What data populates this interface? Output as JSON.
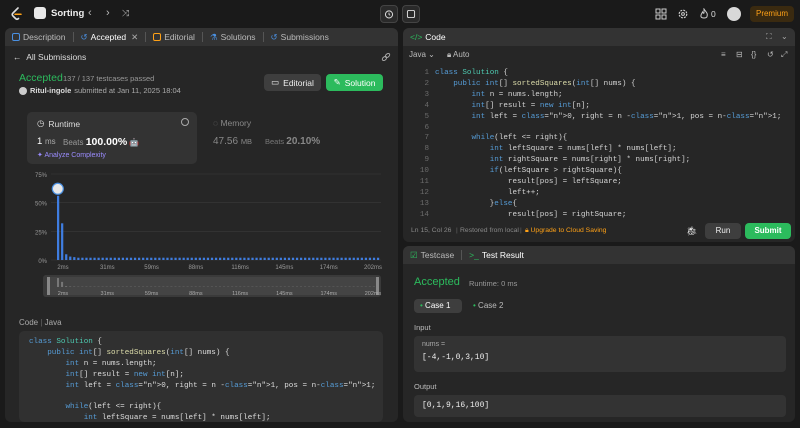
{
  "topnav": {
    "problem_list_label": "Sorting",
    "coins": "0",
    "premium_label": "Premium",
    "colors": {
      "premium_text": "#ffa116",
      "accent_green": "#2cbb5d"
    }
  },
  "left": {
    "tabs": [
      {
        "label": "Description"
      },
      {
        "label": "Accepted"
      },
      {
        "label": "Editorial"
      },
      {
        "label": "Solutions"
      },
      {
        "label": "Submissions"
      }
    ],
    "all_submissions": "All Submissions",
    "status": "Accepted",
    "testcases": "137 / 137 testcases passed",
    "user": "Ritul-ingole",
    "submitted_text": "submitted at Jan 11, 2025 18:04",
    "editorial_button": "Editorial",
    "solution_button": "Solution",
    "runtime": {
      "title": "Runtime",
      "value": "1",
      "unit": "ms",
      "beats_label": "Beats",
      "beats_value": "100.00%",
      "analyze": "Analyze Complexity"
    },
    "memory": {
      "title": "Memory",
      "value": "47.56",
      "unit": "MB",
      "beats_label": "Beats",
      "beats_value": "20.10%"
    },
    "code_label": "Code",
    "code_lang": "Java",
    "code_lines": [
      "class Solution {",
      "    public int[] sortedSquares(int[] nums) {",
      "        int n = nums.length;",
      "        int[] result = new int[n];",
      "        int left = 0, right = n -1, pos = n-1;",
      "",
      "        while(left <= right){",
      "            int leftSquare = nums[left] * nums[left];"
    ]
  },
  "chart_data": {
    "type": "bar",
    "ylabel_ticks": [
      "75%",
      "50%",
      "25%",
      "0%"
    ],
    "ylim": [
      0,
      75
    ],
    "x_tick_labels": [
      "2ms",
      "31ms",
      "59ms",
      "88ms",
      "116ms",
      "145ms",
      "174ms",
      "202ms"
    ],
    "series": [
      {
        "values": [
          56,
          32,
          5,
          3,
          2.5,
          2,
          2,
          2,
          2,
          2,
          2,
          2,
          2,
          2,
          2,
          2,
          2,
          2,
          2,
          2,
          2,
          2,
          2,
          2,
          2,
          2,
          2,
          2,
          2,
          2,
          2,
          2,
          2,
          2,
          2,
          2,
          2,
          2,
          2,
          2,
          2,
          2,
          2,
          2,
          2,
          2,
          2,
          2,
          2,
          2,
          2,
          2,
          2,
          2,
          2,
          2,
          2,
          2,
          2,
          2,
          2,
          2,
          2,
          2,
          2,
          2,
          2,
          2,
          2,
          2,
          2,
          2,
          2,
          2,
          2,
          2,
          2,
          2,
          2,
          2
        ]
      }
    ],
    "highlighted_index": 0,
    "minimap_tick_labels": [
      "2ms",
      "31ms",
      "59ms",
      "88ms",
      "116ms",
      "145ms",
      "174ms",
      "202ms"
    ],
    "colors": {
      "bar": "#3f7de0",
      "grid": "#3a3a3a"
    }
  },
  "code": {
    "tab_label": "Code",
    "language": "Java",
    "auto_label": "Auto",
    "line_numbers": [
      "1",
      "2",
      "3",
      "4",
      "5",
      "6",
      "7",
      "8",
      "9",
      "10",
      "11",
      "12",
      "13",
      "14"
    ],
    "lines": [
      "class Solution {",
      "    public int[] sortedSquares(int[] nums) {",
      "        int n = nums.length;",
      "        int[] result = new int[n];",
      "        int left = 0, right = n -1, pos = n-1;",
      "",
      "        while(left <= right){",
      "            int leftSquare = nums[left] * nums[left];",
      "            int rightSquare = nums[right] * nums[right];",
      "            if(leftSquare > rightSquare){",
      "                result[pos] = leftSquare;",
      "                left++;",
      "            }else{",
      "                result[pos] = rightSquare;"
    ],
    "status_position": "Ln 15, Col 26",
    "status_restored": "Restored from local",
    "upgrade": "Upgrade to Cloud Saving",
    "run_button": "Run",
    "submit_button": "Submit"
  },
  "test": {
    "tabs": [
      {
        "label": "Testcase"
      },
      {
        "label": "Test Result"
      }
    ],
    "status": "Accepted",
    "runtime": "Runtime: 0 ms",
    "cases": [
      {
        "label": "Case 1"
      },
      {
        "label": "Case 2"
      }
    ],
    "input_label": "Input",
    "input_var": "nums =",
    "input_value": "[-4,-1,0,3,10]",
    "output_label": "Output",
    "output_value": "[0,1,9,16,100]"
  }
}
